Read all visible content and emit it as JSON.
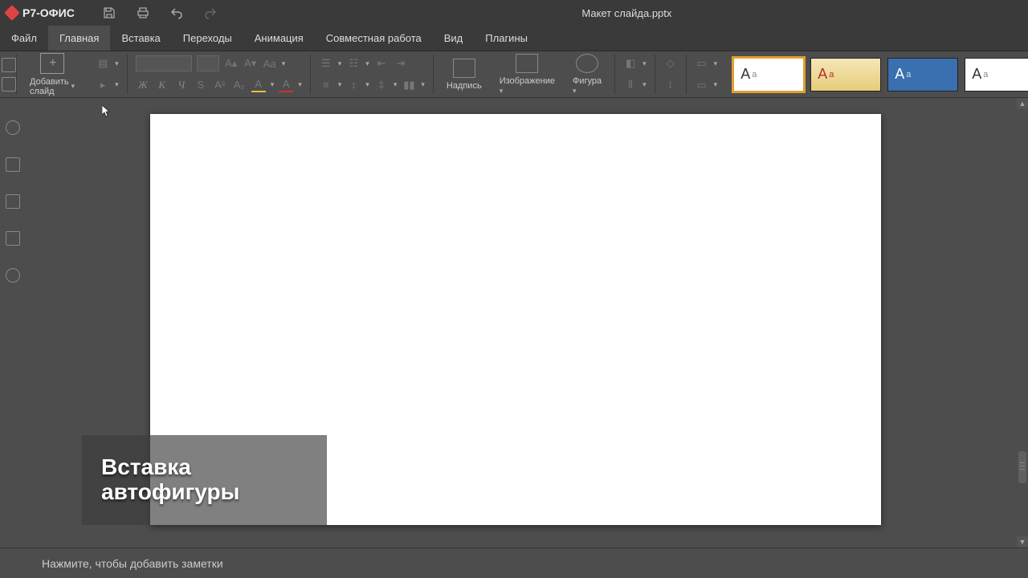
{
  "app": {
    "name": "Р7-ОФИС",
    "doc_title": "Макет слайда.pptx"
  },
  "menu": {
    "items": [
      "Файл",
      "Главная",
      "Вставка",
      "Переходы",
      "Анимация",
      "Совместная работа",
      "Вид",
      "Плагины"
    ],
    "active_index": 1
  },
  "ribbon": {
    "add_slide_label": "Добавить слайд",
    "font_style": {
      "bold": "Ж",
      "italic": "К",
      "underline": "Ч"
    },
    "textbox_label": "Надпись",
    "image_label": "Изображение",
    "shape_label": "Фигура"
  },
  "themes": {
    "glyph_main": "A",
    "glyph_sub": "a",
    "list": [
      "theme-1",
      "theme-2",
      "theme-3",
      "theme-4"
    ],
    "selected_index": 0
  },
  "overlay": {
    "line1": "Вставка",
    "line2": "автофигуры"
  },
  "notes": {
    "placeholder": "Нажмите, чтобы добавить заметки"
  },
  "icons": {
    "save": "save-icon",
    "print": "print-icon",
    "undo": "undo-icon",
    "redo": "redo-icon"
  }
}
